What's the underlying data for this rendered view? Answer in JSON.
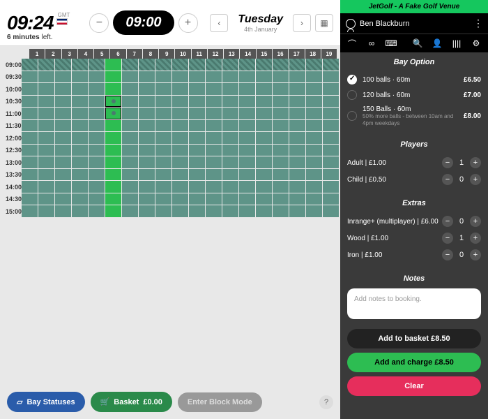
{
  "clock": {
    "time": "09:24",
    "tz": "GMT",
    "left_bold": "6 minutes",
    "left_rest": " left."
  },
  "picker": {
    "time": "09:00"
  },
  "date": {
    "day": "Tuesday",
    "sub": "4th January"
  },
  "bays": [
    "1",
    "2",
    "3",
    "4",
    "5",
    "6",
    "7",
    "8",
    "9",
    "10",
    "11",
    "12",
    "13",
    "14",
    "15",
    "16",
    "17",
    "18",
    "19"
  ],
  "times": [
    "09:00",
    "09:30",
    "10:00",
    "10:30",
    "11:00",
    "11:30",
    "12:00",
    "12:30",
    "13:00",
    "13:30",
    "14:00",
    "14:30",
    "15:00"
  ],
  "footer": {
    "statuses": "Bay Statuses",
    "basket": "Basket ",
    "basket_amt": "£0.00",
    "block": "Enter Block Mode"
  },
  "sb": {
    "venue": "JetGolf - A Fake Golf Venue",
    "user": "Ben Blackburn",
    "bay_option": "Bay Option",
    "opts": [
      {
        "t": "100 balls · 60m",
        "s": "",
        "p": "£6.50"
      },
      {
        "t": "120 balls · 60m",
        "s": "",
        "p": "£7.00"
      },
      {
        "t": "150 Balls · 60m",
        "s": "50% more balls - between 10am and 4pm weekdays",
        "p": "£8.00"
      }
    ],
    "players": "Players",
    "pl": [
      {
        "l": "Adult | £1.00",
        "v": "1"
      },
      {
        "l": "Child | £0.50",
        "v": "0"
      }
    ],
    "extras": "Extras",
    "ex": [
      {
        "l": "Inrange+ (multiplayer) | £6.00",
        "v": "0"
      },
      {
        "l": "Wood | £1.00",
        "v": "1"
      },
      {
        "l": "Iron | £1.00",
        "v": "0"
      }
    ],
    "notes": "Notes",
    "notes_ph": "Add notes to booking.",
    "add_basket": "Add to basket ",
    "add_basket_amt": "£8.50",
    "add_charge": "Add and charge ",
    "add_charge_amt": "£8.50",
    "clear": "Clear"
  }
}
